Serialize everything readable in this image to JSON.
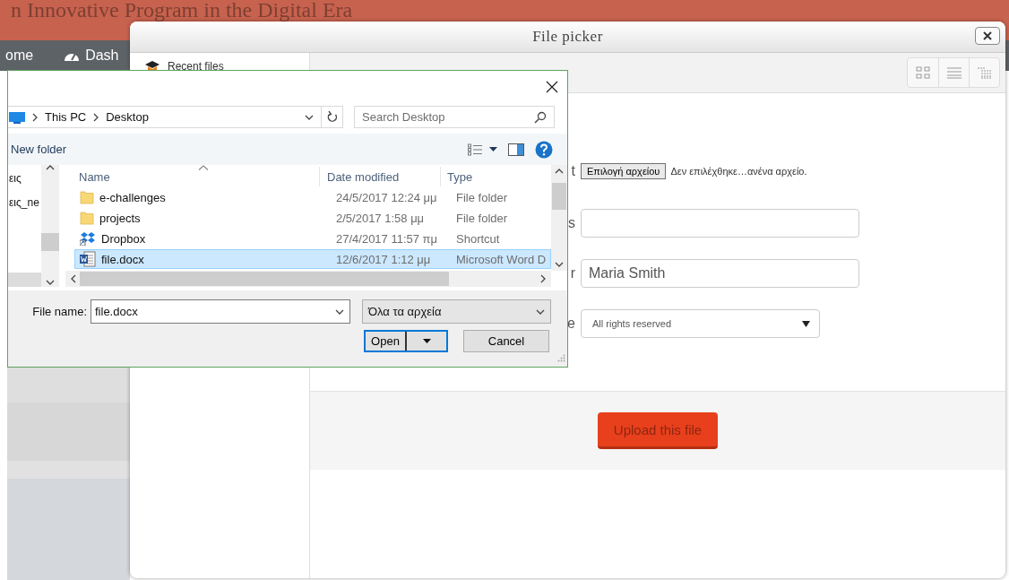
{
  "page": {
    "banner_title": "n Innovative Program in the Digital Era",
    "nav": [
      {
        "label": "ome",
        "kind": "plain"
      },
      {
        "label": "Dash",
        "kind": "dashboard"
      }
    ]
  },
  "file_picker": {
    "title": "File picker",
    "repositories": [
      {
        "label": "Recent files"
      }
    ],
    "form": [
      {
        "kind": "file",
        "label": "t",
        "button": "Επιλογή αρχείου",
        "status": "Δεν επιλέχθηκε…ανένα αρχείο."
      },
      {
        "kind": "text",
        "label": "s"
      },
      {
        "kind": "text",
        "label": "r",
        "value": "Maria Smith"
      },
      {
        "kind": "select",
        "label": "e",
        "value": "All rights reserved"
      }
    ],
    "upload_button": "Upload this file"
  },
  "open_dialog": {
    "path": [
      "This PC",
      "Desktop"
    ],
    "search_placeholder": "Search Desktop",
    "new_folder": "New folder",
    "nav_items": [
      {
        "label": "εις"
      },
      {
        "label": "εις_ne"
      }
    ],
    "columns": [
      "Name",
      "Date modified",
      "Type"
    ],
    "files": [
      {
        "kind": "folder",
        "name": "e-challenges",
        "date": "24/5/2017 12:24 μμ",
        "type": "File folder",
        "selected": false
      },
      {
        "kind": "folder",
        "name": "projects",
        "date": "2/5/2017 1:58 μμ",
        "type": "File folder",
        "selected": false
      },
      {
        "kind": "shortcut",
        "name": "Dropbox",
        "date": "27/4/2017 11:57 πμ",
        "type": "Shortcut",
        "selected": false
      },
      {
        "kind": "word",
        "name": "file.docx",
        "date": "12/6/2017 1:12 μμ",
        "type": "Microsoft Word D",
        "selected": true
      }
    ],
    "file_name_label": "File name:",
    "file_name": "file.docx",
    "filter": "Όλα τα αρχεία",
    "open_button": "Open",
    "cancel_button": "Cancel"
  }
}
